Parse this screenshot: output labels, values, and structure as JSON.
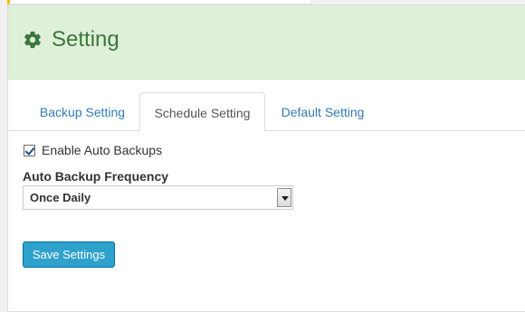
{
  "panel": {
    "title": "Setting",
    "icon": "gear-icon"
  },
  "tabs": [
    {
      "label": "Backup Setting",
      "active": false
    },
    {
      "label": "Schedule Setting",
      "active": true
    },
    {
      "label": "Default Setting",
      "active": false
    }
  ],
  "schedule": {
    "enable_auto_backups": {
      "label": "Enable Auto Backups",
      "checked": true
    },
    "frequency": {
      "label": "Auto Backup Frequency",
      "selected": "Once Daily"
    },
    "save_label": "Save Settings"
  },
  "colors": {
    "heading_bg": "#dff0d8",
    "heading_text": "#3c763d",
    "link": "#337ab7",
    "button": "#2ea2cc"
  }
}
